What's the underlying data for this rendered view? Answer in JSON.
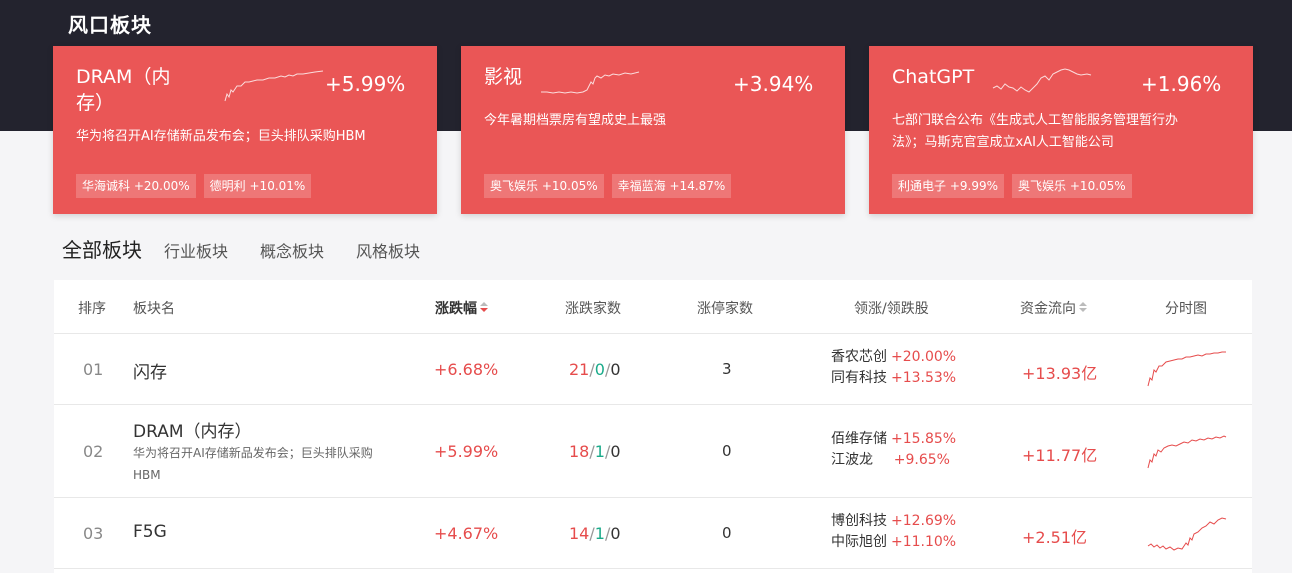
{
  "section_title": "风口板块",
  "hot_cards": [
    {
      "name": "DRAM（内存）",
      "change": "+5.99%",
      "desc": "华为将召开AI存储新品发布会；巨头排队采购HBM",
      "tags": [
        {
          "name": "华海诚科",
          "change": "+20.00%"
        },
        {
          "name": "德明利",
          "change": "+10.01%"
        }
      ]
    },
    {
      "name": "影视",
      "change": "+3.94%",
      "desc": "今年暑期档票房有望成史上最强",
      "tags": [
        {
          "name": "奥飞娱乐",
          "change": "+10.05%"
        },
        {
          "name": "幸福蓝海",
          "change": "+14.87%"
        }
      ]
    },
    {
      "name": "ChatGPT",
      "change": "+1.96%",
      "desc": "七部门联合公布《生成式人工智能服务管理暂行办法》；马斯克官宣成立xAI人工智能公司",
      "tags": [
        {
          "name": "利通电子",
          "change": "+9.99%"
        },
        {
          "name": "奥飞娱乐",
          "change": "+10.05%"
        }
      ]
    }
  ],
  "tabs": [
    "全部板块",
    "行业板块",
    "概念板块",
    "风格板块"
  ],
  "columns": {
    "rank": "排序",
    "name": "板块名",
    "change": "涨跌幅",
    "counts": "涨跌家数",
    "limit_up": "涨停家数",
    "leaders": "领涨/领跌股",
    "flow": "资金流向",
    "chart": "分时图"
  },
  "rows": [
    {
      "rank": "01",
      "name": "闪存",
      "desc": "",
      "change": "+6.68%",
      "up": "21",
      "flat": "0",
      "down": "0",
      "limit_up": "3",
      "leaders": [
        {
          "name": "香农芯创",
          "change": "+20.00%"
        },
        {
          "name": "同有科技",
          "change": "+13.53%"
        }
      ],
      "flow": "+13.93亿"
    },
    {
      "rank": "02",
      "name": "DRAM（内存）",
      "desc": "华为将召开AI存储新品发布会；巨头排队采购HBM",
      "change": "+5.99%",
      "up": "18",
      "flat": "1",
      "down": "0",
      "limit_up": "0",
      "leaders": [
        {
          "name": "佰维存储",
          "change": "+15.85%"
        },
        {
          "name": "江波龙",
          "change": "+9.65%"
        }
      ],
      "flow": "+11.77亿"
    },
    {
      "rank": "03",
      "name": "F5G",
      "desc": "",
      "change": "+4.67%",
      "up": "14",
      "flat": "1",
      "down": "0",
      "limit_up": "0",
      "leaders": [
        {
          "name": "博创科技",
          "change": "+12.69%"
        },
        {
          "name": "中际旭创",
          "change": "+11.10%"
        }
      ],
      "flow": "+2.51亿"
    }
  ],
  "colors": {
    "accent_red": "#ea5656",
    "rise": "#e64c4c",
    "flat": "#1aab8a",
    "header_bg": "#23232e"
  }
}
